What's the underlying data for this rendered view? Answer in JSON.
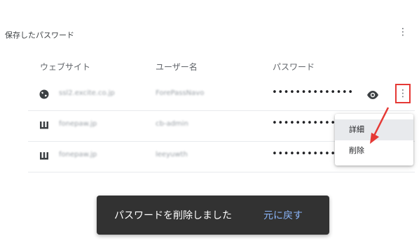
{
  "section": {
    "title": "保存したパスワード",
    "menu_icon": "more-vert-icon"
  },
  "columns": {
    "website": "ウェブサイト",
    "username": "ユーザー名",
    "password": "パスワード"
  },
  "rows": [
    {
      "favicon": "globe-icon",
      "site": "ssl2.excite.co.jp",
      "username": "ForePassNavo",
      "password": "••••••••••••••"
    },
    {
      "favicon": "fonepaw-icon",
      "site": "fonepaw.jp",
      "username": "cb-admin",
      "password": "••••••••••••••"
    },
    {
      "favicon": "fonepaw-icon",
      "site": "fonepaw.jp",
      "username": "leeyuwth",
      "password": "••••••••••••••"
    }
  ],
  "row_actions": {
    "show_icon": "eye-icon",
    "more_icon": "more-vert-icon"
  },
  "context_menu": {
    "details": "詳細",
    "delete": "削除"
  },
  "toast": {
    "message": "パスワードを削除しました",
    "action": "元に戻す"
  },
  "colors": {
    "highlight": "#e53935",
    "toast_bg": "#323232",
    "toast_action": "#8ab4f8"
  }
}
